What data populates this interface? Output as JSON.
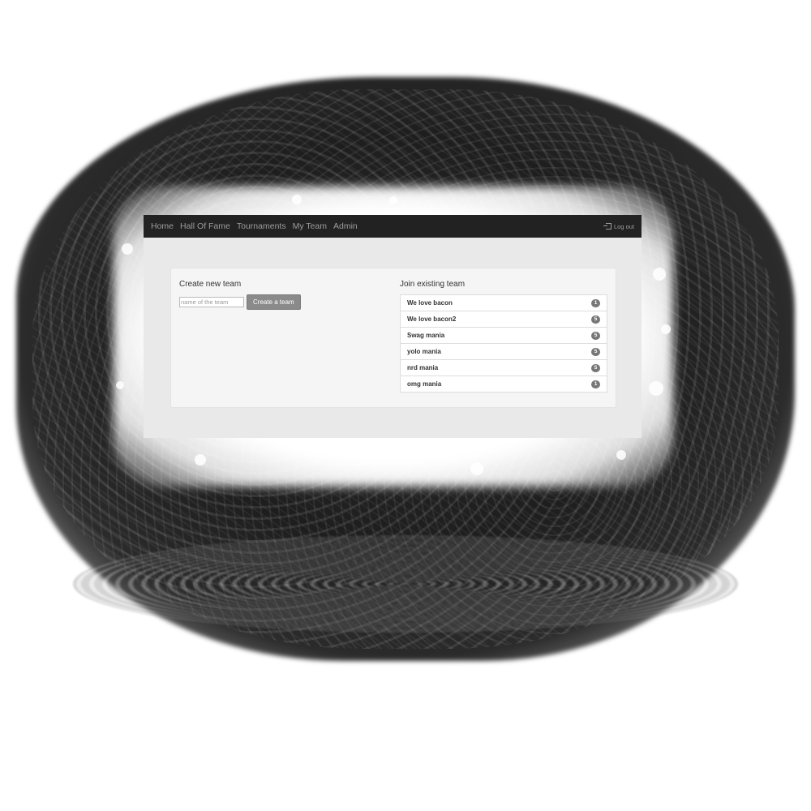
{
  "navbar": {
    "links": [
      "Home",
      "Hall Of Fame",
      "Tournaments",
      "My Team",
      "Admin"
    ],
    "logout_label": "Log out",
    "logout_icon": "logout-icon"
  },
  "create_team": {
    "heading": "Create new team",
    "input_placeholder": "name of the team",
    "input_value": "",
    "button_label": "Create a team"
  },
  "join_team": {
    "heading": "Join existing team",
    "teams": [
      {
        "name": "We love bacon",
        "count": "1"
      },
      {
        "name": "We love bacon2",
        "count": "5"
      },
      {
        "name": "Swag mania",
        "count": "5"
      },
      {
        "name": "yolo mania",
        "count": "5"
      },
      {
        "name": "nrd mania",
        "count": "5"
      },
      {
        "name": "omg mania",
        "count": "1"
      }
    ]
  },
  "colors": {
    "navbar_bg": "#222222",
    "nav_text": "#9d9d9d",
    "badge_bg": "#777777",
    "button_bg": "#8a8a8a"
  }
}
